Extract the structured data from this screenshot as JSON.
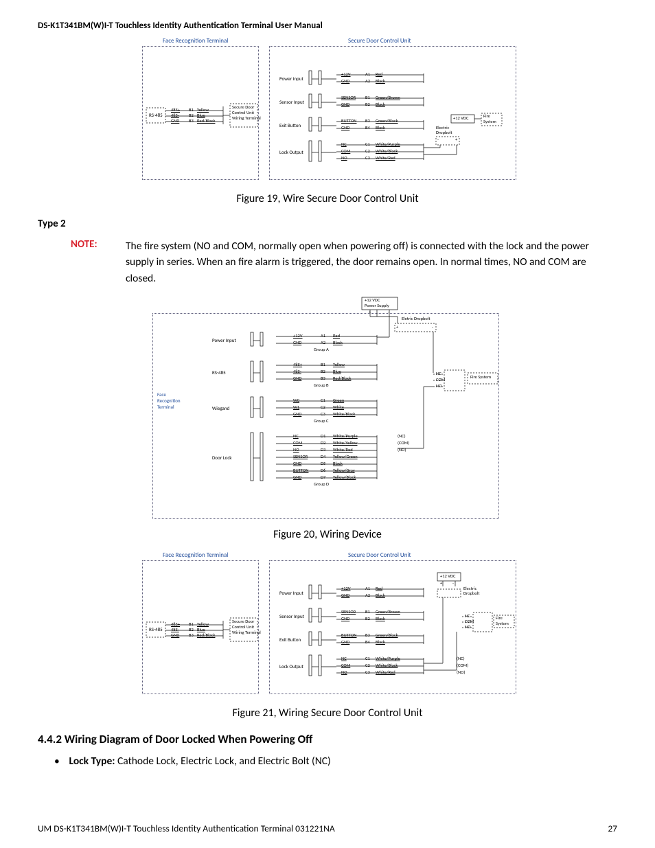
{
  "header": "DS-K1T341BM(W)I-T Touchless Identity Authentication Terminal User Manual",
  "fig19": {
    "caption": "Figure 19, Wire Secure Door Control Unit",
    "frt": "Face Recognition Terminal",
    "sdcu": "Secure Door Control Unit",
    "rs485": "RS-485",
    "rs485_rows": [
      {
        "sig": "485+",
        "pin": "B1",
        "col": "Yellow"
      },
      {
        "sig": "485-",
        "pin": "B2",
        "col": "Blue"
      },
      {
        "sig": "GND",
        "pin": "B3",
        "col": "Red/Black"
      }
    ],
    "sdcu_wt": "Secure Door\nControl Unit\nWiring Terminal",
    "groups": [
      {
        "name": "Power Input",
        "rows": [
          {
            "sig": "+12V",
            "pin": "A1",
            "col": "Red"
          },
          {
            "sig": "GND",
            "pin": "A2",
            "col": "Black"
          }
        ]
      },
      {
        "name": "Sensor Input",
        "rows": [
          {
            "sig": "SENSOR",
            "pin": "B1",
            "col": "Green/Brown"
          },
          {
            "sig": "GND",
            "pin": "B2",
            "col": "Black"
          }
        ]
      },
      {
        "name": "Exit Button",
        "rows": [
          {
            "sig": "BUTTON",
            "pin": "B3",
            "col": "Green/Black"
          },
          {
            "sig": "GND",
            "pin": "B4",
            "col": "Black"
          }
        ]
      },
      {
        "name": "Lock Output",
        "rows": [
          {
            "sig": "NC",
            "pin": "C1",
            "col": "White/Purple"
          },
          {
            "sig": "COM",
            "pin": "C2",
            "col": "White/Black"
          },
          {
            "sig": "NO",
            "pin": "C3",
            "col": "White/Red"
          }
        ]
      }
    ],
    "plus12vdc": "+12 VDC",
    "elec_dropbolt": "Electric\nDropbolt",
    "fire": "Fire\nSystem"
  },
  "type2_heading": "Type 2",
  "note_label": "NOTE:",
  "note_text": "The fire system (NO and COM, normally open when powering off) is connected with the lock and the power supply in series. When an fire alarm is triggered, the door remains open. In normal times, NO and COM are closed.",
  "fig20": {
    "caption": "Figure 20, Wiring Device",
    "frt": "Face\nRecognition\nTerminal",
    "power_supply": "+12 VDC\nPower Supply",
    "elec_dropbolt": "Eletric Dropbolt",
    "fire": "Fire System",
    "fire_pins": [
      "NC",
      "COM",
      "NO"
    ],
    "groups": [
      {
        "name": "Power Input",
        "footer": "Group A",
        "rows": [
          {
            "sig": "+12V",
            "pin": "A1",
            "col": "Red"
          },
          {
            "sig": "GND",
            "pin": "A2",
            "col": "Black"
          }
        ]
      },
      {
        "name": "RS-485",
        "footer": "Group B",
        "rows": [
          {
            "sig": "485+",
            "pin": "B1",
            "col": "Yellow"
          },
          {
            "sig": "485-",
            "pin": "B2",
            "col": "Blue"
          },
          {
            "sig": "GND",
            "pin": "B3",
            "col": "Red/Black"
          }
        ]
      },
      {
        "name": "Wiegand",
        "footer": "Group C",
        "rows": [
          {
            "sig": "W0",
            "pin": "C1",
            "col": "Green"
          },
          {
            "sig": "W1",
            "pin": "C2",
            "col": "White"
          },
          {
            "sig": "GND",
            "pin": "C3",
            "col": "White/Black"
          }
        ]
      },
      {
        "name": "Door Lock",
        "footer": "Group D",
        "rows": [
          {
            "sig": "NC",
            "pin": "D1",
            "col": "White/Purple",
            "note": "(NC)"
          },
          {
            "sig": "COM",
            "pin": "D2",
            "col": "White/Yellow",
            "note": "(COM)"
          },
          {
            "sig": "NO",
            "pin": "D3",
            "col": "White/Red",
            "note": "(NO)"
          },
          {
            "sig": "SENSOR",
            "pin": "D4",
            "col": "Yellow/Green"
          },
          {
            "sig": "GND",
            "pin": "D5",
            "col": "Black"
          },
          {
            "sig": "BUTTON",
            "pin": "D6",
            "col": "Yellow/Gray"
          },
          {
            "sig": "GND",
            "pin": "D7",
            "col": "Yellow/Black"
          }
        ]
      }
    ]
  },
  "fig21": {
    "caption": "Figure 21, Wiring Secure Door Control Unit",
    "frt": "Face Recognition Terminal",
    "sdcu": "Secure Door Control Unit",
    "rs485": "RS-485",
    "rs485_rows": [
      {
        "sig": "485+",
        "pin": "B1",
        "col": "Yellow"
      },
      {
        "sig": "485-",
        "pin": "B2",
        "col": "Blue"
      },
      {
        "sig": "GND",
        "pin": "B3",
        "col": "Red/Black"
      }
    ],
    "sdcu_wt": "Secure Door\nControl Unit\nWiring Terminal",
    "groups": [
      {
        "name": "Power Input",
        "rows": [
          {
            "sig": "+12V",
            "pin": "A1",
            "col": "Red"
          },
          {
            "sig": "GND",
            "pin": "A2",
            "col": "Black"
          }
        ]
      },
      {
        "name": "Sensor Input",
        "rows": [
          {
            "sig": "SENSOR",
            "pin": "B1",
            "col": "Green/Brown"
          },
          {
            "sig": "GND",
            "pin": "B2",
            "col": "Black"
          }
        ]
      },
      {
        "name": "Exit Button",
        "rows": [
          {
            "sig": "BUTTON",
            "pin": "B3",
            "col": "Green/Black"
          },
          {
            "sig": "GND",
            "pin": "B4",
            "col": "Black"
          }
        ]
      },
      {
        "name": "Lock Output",
        "rows": [
          {
            "sig": "NC",
            "pin": "C1",
            "col": "White/Purple",
            "note": "(NC)"
          },
          {
            "sig": "COM",
            "pin": "C2",
            "col": "White/Black",
            "note": "(COM)"
          },
          {
            "sig": "NO",
            "pin": "C3",
            "col": "White/Red",
            "note": "(NO)"
          }
        ]
      }
    ],
    "plus12vdc": "+12 VDC",
    "elec_dropbolt": "Electric\nDropbolt",
    "fire": "Fire\nSystem",
    "fire_pins": [
      "NC",
      "COM",
      "NO"
    ]
  },
  "section_442": "4.4.2 Wiring Diagram of Door Locked When Powering Off",
  "lock_type_label": "Lock Type:",
  "lock_type_value": " Cathode Lock, Electric Lock, and Electric Bolt (NC)",
  "footer_text": "UM DS-K1T341BM(W)I-T Touchless Identity Authentication Terminal 031221NA",
  "page_number": "27"
}
